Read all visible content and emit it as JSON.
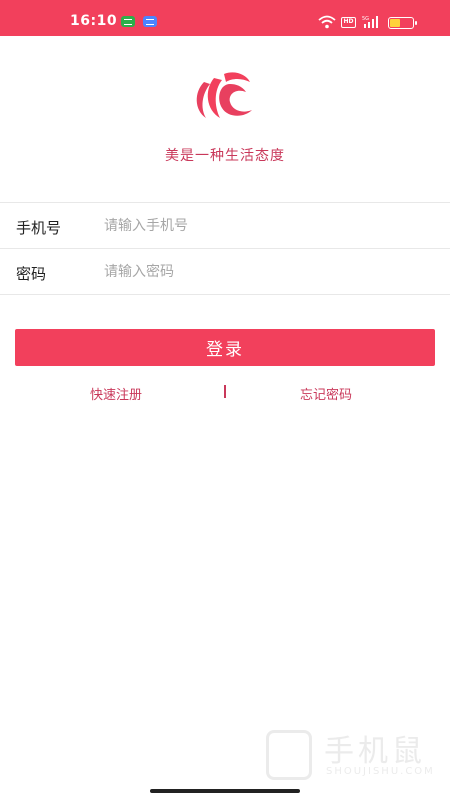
{
  "status_bar": {
    "time": "16:10",
    "hd_label": "HD",
    "network_label": "5G",
    "icons": [
      "wechat-notification-icon",
      "message-notification-icon",
      "wifi-icon",
      "hd-icon",
      "signal-icon",
      "battery-icon"
    ],
    "battery_level": 0.4,
    "background_color": "#f2405c"
  },
  "app": {
    "logo_icon": "brand-logo-icon",
    "slogan": "美是一种生活态度",
    "accent_color": "#f2405c",
    "link_color": "#c9385a"
  },
  "form": {
    "phone": {
      "label": "手机号",
      "placeholder": "请输入手机号",
      "value": ""
    },
    "password": {
      "label": "密码",
      "placeholder": "请输入密码",
      "value": ""
    }
  },
  "actions": {
    "login_label": "登录",
    "register_label": "快速注册",
    "divider": "|",
    "forgot_label": "忘记密码"
  },
  "watermark": {
    "text": "手机鼠",
    "sub": "SHOUJISHU.COM"
  }
}
